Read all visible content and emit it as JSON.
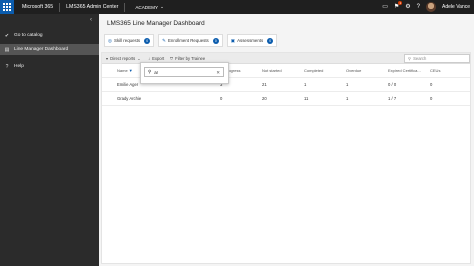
{
  "topbar": {
    "brand": "Microsoft 365",
    "app": "LMS365 Admin Center",
    "org": "ACADEMY",
    "user": "Adele Vance",
    "notif_count": "1"
  },
  "nav": {
    "items": [
      {
        "label": "Go to catalog",
        "icon": "check-circle-icon"
      },
      {
        "label": "Line Manager Dashboard",
        "icon": "dashboard-icon"
      },
      {
        "label": "Help",
        "icon": "help-icon"
      }
    ]
  },
  "main": {
    "title": "LMS365 Line Manager Dashboard",
    "tiles": [
      {
        "label": "Skill requests",
        "count": "0"
      },
      {
        "label": "Enrollment Requests",
        "count": "0"
      },
      {
        "label": "Assessments",
        "count": "0"
      }
    ],
    "filterbar": {
      "direct_reports": "Direct reports",
      "export": "Export",
      "filter_by_trainee": "Filter by Trainee",
      "search_placeholder": "Search"
    },
    "columns": [
      "Name",
      "In Progress",
      "Not started",
      "Completed",
      "Overdue",
      "Expired Certifica...",
      "CEUs"
    ],
    "rows": [
      {
        "name": "Emilie Ager",
        "in_progress": "3",
        "not_started": "21",
        "completed": "1",
        "overdue": "1",
        "expired": "0 / 0",
        "ceus": "0"
      },
      {
        "name": "Grady Archie",
        "in_progress": "0",
        "not_started": "20",
        "completed": "11",
        "overdue": "1",
        "expired": "1 / 7",
        "ceus": "0"
      }
    ],
    "popup": {
      "value": "ar"
    }
  },
  "colors": {
    "accent": "#0b5cad",
    "topbar": "#1f1f1f",
    "nav": "#2b2b2b"
  }
}
